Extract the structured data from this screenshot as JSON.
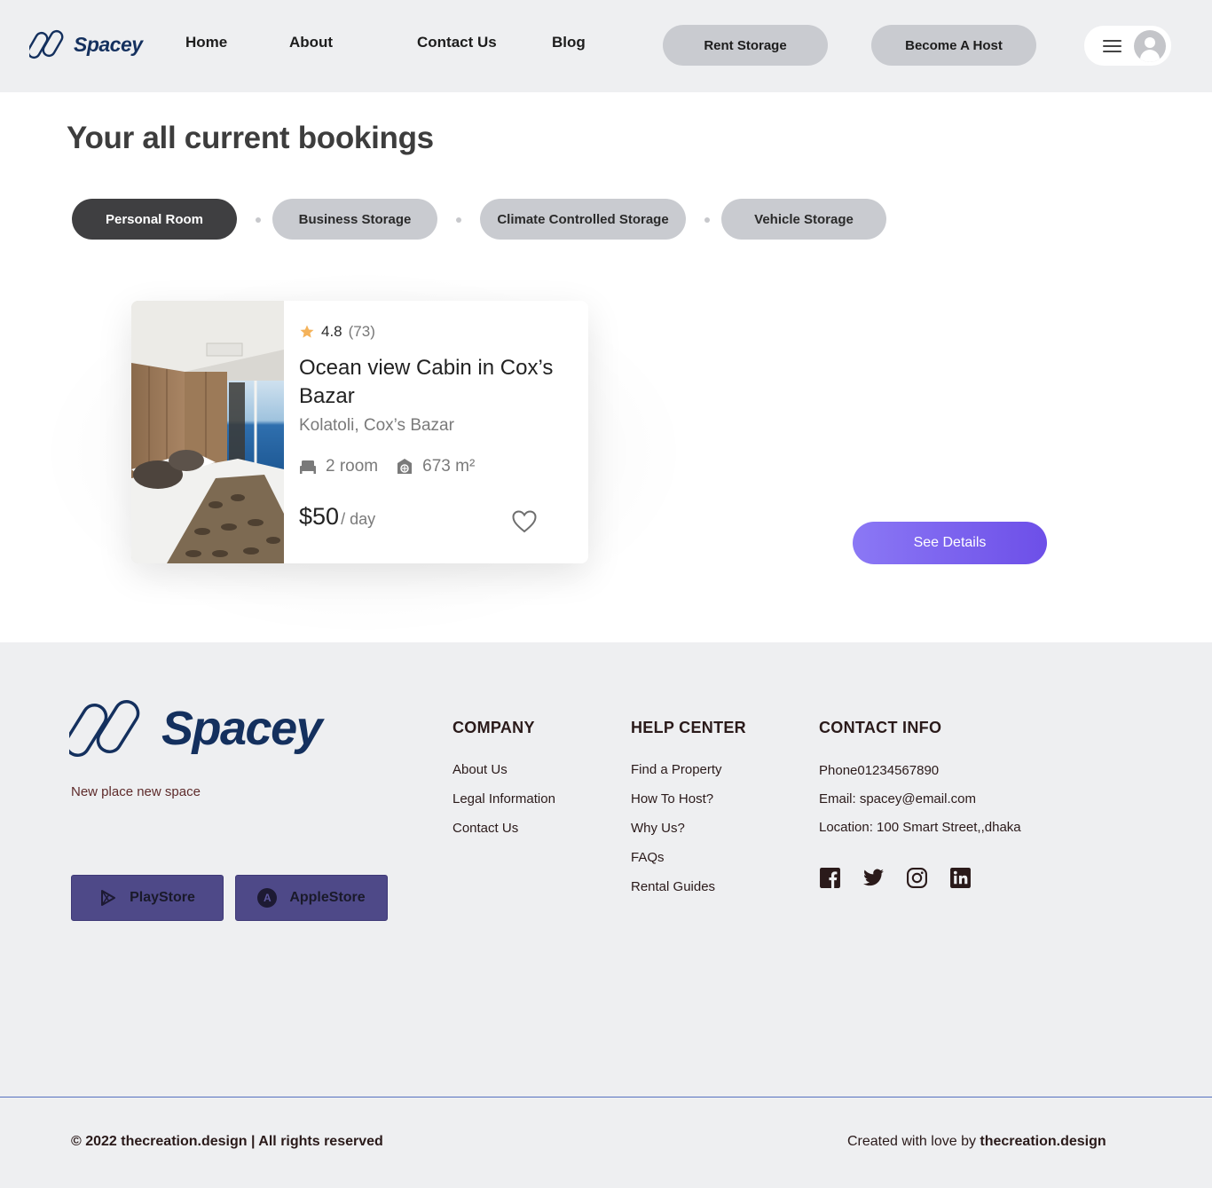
{
  "brand": {
    "name": "Spacey",
    "color": "#14305e"
  },
  "nav": {
    "links": [
      "Home",
      "About",
      "Contact Us",
      "Blog"
    ],
    "rent_storage": "Rent Storage",
    "become_host": "Become A Host"
  },
  "page": {
    "title": "Your all current bookings"
  },
  "tabs": [
    {
      "label": "Personal Room",
      "active": true
    },
    {
      "label": "Business Storage",
      "active": false
    },
    {
      "label": "Climate Controlled Storage",
      "active": false
    },
    {
      "label": "Vehicle Storage",
      "active": false
    }
  ],
  "booking": {
    "rating": "4.8",
    "reviews": "(73)",
    "title": "Ocean view Cabin in Cox’s Bazar",
    "location": "Kolatoli, Cox’s Bazar",
    "rooms": "2 room",
    "area": "673 m²",
    "price": "$50",
    "price_unit": "/ day",
    "see_details": "See Details"
  },
  "footer": {
    "logo": "Spacey",
    "tagline": "New place new  space",
    "playstore": "PlayStore",
    "applestore": "AppleStore",
    "company": {
      "heading": "COMPANY",
      "links": [
        "About Us",
        "Legal Information",
        "Contact Us"
      ]
    },
    "help": {
      "heading": "HELP CENTER",
      "links": [
        "Find a Property",
        "How To Host?",
        "Why Us?",
        "FAQs",
        "Rental Guides"
      ]
    },
    "contact": {
      "heading": "CONTACT INFO",
      "phone": "Phone01234567890",
      "email": "Email: spacey@email.com",
      "location": "Location: 100 Smart Street,,dhaka"
    },
    "social_icons": [
      "facebook-icon",
      "twitter-icon",
      "instagram-icon",
      "linkedin-icon"
    ],
    "copyright": "© 2022 thecreation.design | All rights reserved",
    "credit_prefix": "Created with love by ",
    "credit_name": "thecreation.design"
  },
  "colors": {
    "accent_start": "#8b78f5",
    "accent_end": "#6d4fe8",
    "store_button": "#4e4988",
    "active_tab": "#3f3f41"
  }
}
